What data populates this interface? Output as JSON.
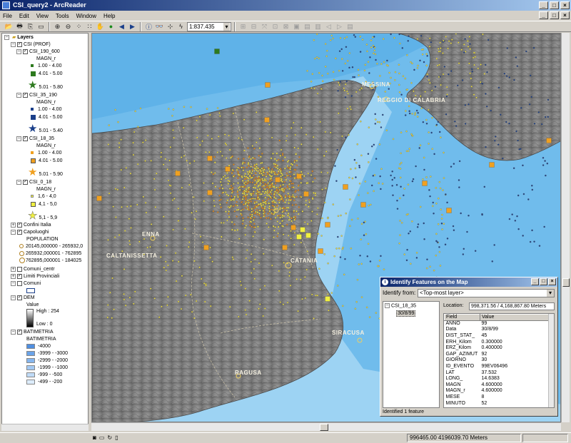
{
  "window": {
    "title": "CSI_query2 - ArcReader"
  },
  "menu": {
    "items": [
      "File",
      "Edit",
      "View",
      "Tools",
      "Window",
      "Help"
    ]
  },
  "toolbar": {
    "scale": "1:837.435"
  },
  "toc": {
    "root": "Layers",
    "group": "CSI (PROF)",
    "layers": [
      {
        "name": "CSI_190_600",
        "field": "MAGN_r",
        "classes": [
          "1.00 - 4.00",
          "4.01 - 5.00",
          "5.01 - 5.80"
        ],
        "color": "#2d7a1e"
      },
      {
        "name": "CSI_35_190",
        "field": "MAGN_r",
        "classes": [
          "1.00 - 4.00",
          "4.01 - 5.00",
          "5.01 - 5.40"
        ],
        "color": "#1a3f8a"
      },
      {
        "name": "CSI_18_35",
        "field": "MAGN_r",
        "classes": [
          "1.00 - 4.00",
          "4.01 - 5.00",
          "5.01 - 5.90"
        ],
        "color": "#f0a020"
      },
      {
        "name": "CSI_0_18",
        "field": "MAGN_r",
        "classes": [
          "1,6 - 4,0",
          "4,1 - 5,0",
          "5,1 - 5,9"
        ],
        "color": "#f0f040"
      }
    ],
    "confini": "Confini Italia",
    "capoluoghi": "Capoluoghi",
    "population_label": "POPULATION",
    "population_classes": [
      "20145,000000 - 265932,0",
      "265932,000001 - 762895",
      "762895,000001 - 184025"
    ],
    "comuni_centr": "Comuni_centr",
    "limiti": "Limiti Provinciali",
    "comuni": "Comuni",
    "dem": "DEM",
    "dem_value": "Value",
    "dem_high": "High : 254",
    "dem_low": "Low : 0",
    "batimetria": "BATIMETRIA",
    "batimetria_field": "BATIMETRIA",
    "bat_classes": [
      {
        "label": "-4000",
        "color": "#4f8fe0"
      },
      {
        "label": "-3999 - -3000",
        "color": "#6aa3e8"
      },
      {
        "label": "-2999 - -2000",
        "color": "#86b6ee"
      },
      {
        "label": "-1999 - -1000",
        "color": "#a3c9f3"
      },
      {
        "label": "-999 - -500",
        "color": "#c0dbf7"
      },
      {
        "label": "-499 - -200",
        "color": "#dcecfb"
      }
    ]
  },
  "map": {
    "labels": [
      "MESSINA",
      "REGGIO DI CALABRIA",
      "ENNA",
      "CALTANISSETTA",
      "CATANIA",
      "SIRACUSA",
      "RAGUSA"
    ]
  },
  "identify": {
    "title": "Identify Features on the Map",
    "from_label": "Identify from:",
    "from_value": "<Top-most layer>",
    "tree_layer": "CSI_18_35",
    "tree_item": "30/8/99",
    "location_label": "Location:",
    "location_value": "998,371.56 / 4,168,867.80 Meters",
    "col_field": "Field",
    "col_value": "Value",
    "rows": [
      [
        "ANNO",
        "99"
      ],
      [
        "Data",
        "30/8/99"
      ],
      [
        "DIST_STAT_",
        "45"
      ],
      [
        "ERH_Kilom",
        "0.300000"
      ],
      [
        "ERZ_Kilom",
        "0.400000"
      ],
      [
        "GAP_AZIMUT",
        "92"
      ],
      [
        "GIORNO",
        "30"
      ],
      [
        "ID_EVENTO",
        "99EV06496"
      ],
      [
        "LAT",
        "37.532"
      ],
      [
        "LONG_",
        "14.6383"
      ],
      [
        "MAGN",
        "4.600000"
      ],
      [
        "MAGN_r",
        "4.600000"
      ],
      [
        "MESE",
        "8"
      ],
      [
        "MINUTO",
        "52"
      ]
    ],
    "status": "Identified 1 feature"
  },
  "status": {
    "coords": "996465.00  4196039.70 Meters"
  }
}
